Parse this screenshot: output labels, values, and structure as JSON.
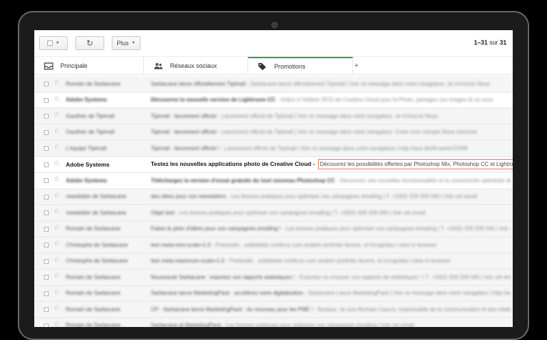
{
  "toolbar": {
    "more_label": "Plus",
    "pager": {
      "range": "1–31",
      "of_word": "sur",
      "total": "31"
    }
  },
  "tabs": [
    {
      "label": "Principale",
      "icon": "inbox-icon"
    },
    {
      "label": "Réseaux sociaux",
      "icon": "people-icon"
    },
    {
      "label": "Promotions",
      "icon": "tag-icon",
      "active": true
    }
  ],
  "tab_add_label": "+",
  "colors": {
    "active_tab": "#2f9e5e",
    "highlight_border": "#e8785e"
  },
  "emails": [
    {
      "sender": "Romain de Sarbacane",
      "subject": "Sarbacane lance officiellement Tipimail",
      "snippet": " - Sarbacane lance officiellement Tipimail | Voir ce message dans votre navigateur. Je m'inscris Nous",
      "unread": false,
      "blurred": true
    },
    {
      "sender": "Adobe Systems",
      "subject": "Découvrez la nouvelle version de Lightroom CC",
      "snippet": " - Grâce à l'édition 2015 de Creative Cloud pour la Photo, partagez vos images là où vous",
      "unread": true,
      "blurred": true
    },
    {
      "sender": "Gauthier de Tipimail",
      "subject": "Tipimail : lancement officiel",
      "snippet": " - Lancement officiel de Tipimail | Voir ce message dans votre navigateur. Je m'inscris Nous",
      "unread": false,
      "blurred": true
    },
    {
      "sender": "Gauthier de Tipimail",
      "subject": "Tipimail : lancement officiel",
      "snippet": " - Lancement officiel de Tipimail | Voir ce message dans votre navigateur. Créer mon compte Nous sommes",
      "unread": false,
      "blurred": true
    },
    {
      "sender": "L'équipe Tipimail",
      "subject": "Tipimail : lancement officiel !",
      "snippet": " - Lancement officiel de Tipimail | Voir ce message dans votre navigateur | http://aue.tle/r8-sentrc2V4/8",
      "unread": false,
      "blurred": true
    },
    {
      "sender": "Adobe Systems",
      "subject": "Testez les nouvelles applications photo de Creative Cloud",
      "separator": " - ",
      "snippet": "Découvrez les possibilités offertes par Photoshop Mix, Photoshop CC et Lightroom CC.",
      "unread": true,
      "blurred": false,
      "focus": true
    },
    {
      "sender": "Adobe Systems",
      "subject": "Téléchargez la version d'essai gratuite du tout nouveau Photoshop CC",
      "snippet": " - Découvrez ses nouvelles fonctionnalités et la connectivité optimisée de Creative",
      "unread": true,
      "blurred": true
    },
    {
      "sender": "newsletter de Sarbacane",
      "subject": "des idées pour vos newsletters",
      "snippet": " - Les bonnes pratiques pour optimiser vos campagnes emailing | T. +33(0) 328 328 040 | Voir cet email",
      "unread": false,
      "blurred": true
    },
    {
      "sender": "newsletter de Sarbacane",
      "subject": "Objet test",
      "snippet": " - Les bonnes pratiques pour optimiser vos campagnes emailing | T. +33(0) 328 328 040 | Voir cet email",
      "unread": false,
      "blurred": true
    },
    {
      "sender": "Romain de Sarbacane",
      "subject": "Faites le plein d'idées pour vos campagnes emailing !",
      "snippet": " - Les bonnes pratiques pour optimiser vos campagnes emailing | T. +33(0) 328 328 040 | Voir cet email",
      "unread": false,
      "blurred": true
    },
    {
      "sender": "Christophe de Sarbacane",
      "subject": "test meta-mini-scale=1.0",
      "snippet": " - Pretsealic . sollatidete conficus cum sealem porttritie facens, et incognitas | view in browser ",
      "unread": false,
      "blurred": true
    },
    {
      "sender": "Christophe de Sarbacane",
      "subject": "test meta-maximum-scale=1.0",
      "snippet": " - Pretsealic . sollatidete conficus cum sealem porttritie facens, et incognitas | view in browser ",
      "unread": false,
      "blurred": true
    },
    {
      "sender": "Romain de Sarbacane",
      "subject": "Nouveauté Sarbacane : exportez vos rapports statistiques !",
      "snippet": " - Exportez ou envoyer vos rapports de statistiques ! | T. +33(0) 328 328 040 | Voir cet email",
      "unread": false,
      "blurred": true
    },
    {
      "sender": "Romain de Sarbacane",
      "subject": "Sarbacane lance MarketingPack : accélérez votre digitalisation",
      "snippet": " - Sarbacane Lance MarketingPack | Voir ce message dans votre navigateur | http://aue.sarbacane.com",
      "unread": false,
      "blurred": true
    },
    {
      "sender": "Romain de Sarbacane",
      "subject": "CP - Sarbacane lance MarketingPack : du nouveau pour les PME !",
      "snippet": " - Bonjour, Je suis Romain Caucry, responsable de la communication et des relations presse",
      "unread": false,
      "blurred": true
    },
    {
      "sender": "Romain de Sarbacane",
      "subject": "Sarbacane et MarketingPack",
      "snippet": " - Les bonnes pratiques pour optimiser vos campagnes emailing | Voir cet email",
      "unread": false,
      "blurred": true
    }
  ]
}
